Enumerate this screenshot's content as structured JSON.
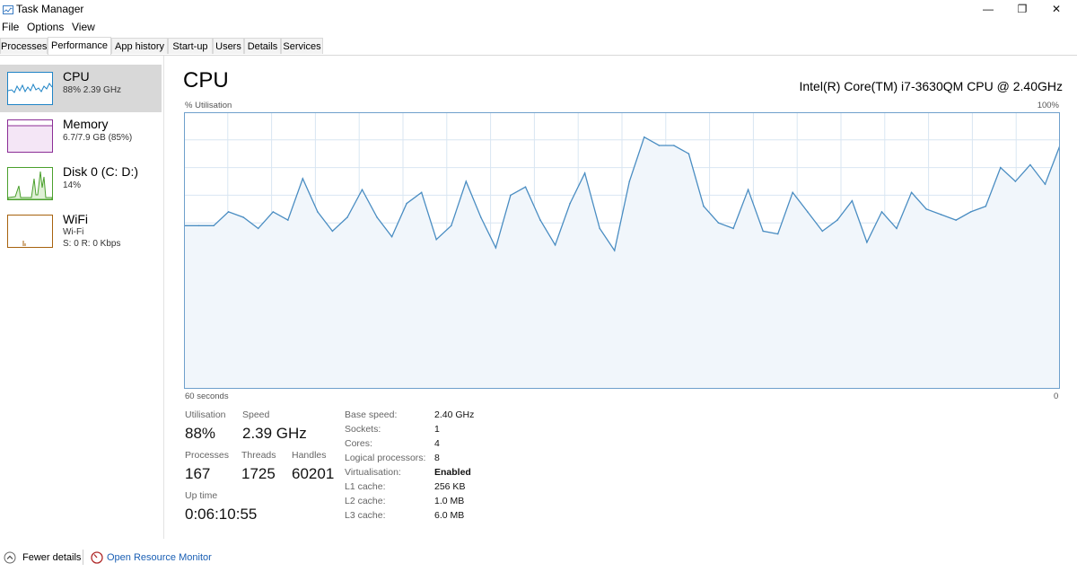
{
  "window": {
    "title": "Task Manager",
    "minimize": "—",
    "maximize": "❐",
    "close": "✕"
  },
  "menu": [
    "File",
    "Options",
    "View"
  ],
  "tabs": [
    "Processes",
    "Performance",
    "App history",
    "Start-up",
    "Users",
    "Details",
    "Services"
  ],
  "active_tab": "Performance",
  "sidebar": [
    {
      "title": "CPU",
      "line1": "88%  2.39 GHz",
      "line2": "",
      "color": "#1f84c6"
    },
    {
      "title": "Memory",
      "line1": "6.7/7.9 GB (85%)",
      "line2": "",
      "color": "#8b2d96"
    },
    {
      "title": "Disk 0 (C: D:)",
      "line1": "14%",
      "line2": "",
      "color": "#4aa02c"
    },
    {
      "title": "WiFi",
      "line1": "Wi-Fi",
      "line2": "S: 0  R: 0 Kbps",
      "color": "#a7620d"
    }
  ],
  "main": {
    "heading": "CPU",
    "model": "Intel(R) Core(TM) i7-3630QM CPU @ 2.40GHz",
    "ylabel": "% Utilisation",
    "ymax_label": "100%",
    "xlabel_left": "60 seconds",
    "xlabel_right": "0"
  },
  "stats": {
    "utilisation_label": "Utilisation",
    "utilisation": "88%",
    "speed_label": "Speed",
    "speed": "2.39 GHz",
    "processes_label": "Processes",
    "processes": "167",
    "threads_label": "Threads",
    "threads": "1725",
    "handles_label": "Handles",
    "handles": "60201",
    "uptime_label": "Up time",
    "uptime": "0:06:10:55"
  },
  "specs": [
    {
      "label": "Base speed:",
      "value": "2.40 GHz"
    },
    {
      "label": "Sockets:",
      "value": "1"
    },
    {
      "label": "Cores:",
      "value": "4"
    },
    {
      "label": "Logical processors:",
      "value": "8"
    },
    {
      "label": "Virtualisation:",
      "value": "Enabled",
      "bold": true
    },
    {
      "label": "L1 cache:",
      "value": "256 KB"
    },
    {
      "label": "L2 cache:",
      "value": "1.0 MB"
    },
    {
      "label": "L3 cache:",
      "value": "6.0 MB"
    }
  ],
  "footer": {
    "fewer_details": "Fewer details",
    "open_resource_monitor": "Open Resource Monitor"
  },
  "colors": {
    "cpu_line": "#4a8dc2",
    "cpu_fill": "#f1f6fb",
    "grid": "#d9e6f2",
    "graph_border": "#6fa0cc",
    "link": "#1a5fb4"
  },
  "chart_data": {
    "type": "area",
    "x": [
      60,
      59,
      58,
      57,
      56,
      55,
      54,
      53,
      52,
      51,
      50,
      49,
      48,
      47,
      46,
      45,
      44,
      43,
      42,
      41,
      40,
      39,
      38,
      37,
      36,
      35,
      34,
      33,
      32,
      31,
      30,
      29,
      28,
      27,
      26,
      25,
      24,
      23,
      22,
      21,
      20,
      19,
      18,
      17,
      16,
      15,
      14,
      13,
      12,
      11,
      10,
      9,
      8,
      7,
      6,
      5,
      4,
      3,
      2,
      1,
      0
    ],
    "values": [
      59,
      59,
      59,
      64,
      62,
      58,
      64,
      61,
      76,
      64,
      57,
      62,
      72,
      62,
      55,
      67,
      71,
      54,
      59,
      75,
      62,
      51,
      70,
      73,
      61,
      52,
      67,
      78,
      58,
      50,
      75,
      91,
      88,
      88,
      85,
      66,
      60,
      58,
      72,
      57,
      56,
      71,
      64,
      57,
      61,
      68,
      53,
      64,
      58,
      71,
      65,
      63,
      61,
      64,
      66,
      80,
      75,
      81,
      74,
      88
    ],
    "ylim": [
      0,
      100
    ],
    "grid": true
  }
}
